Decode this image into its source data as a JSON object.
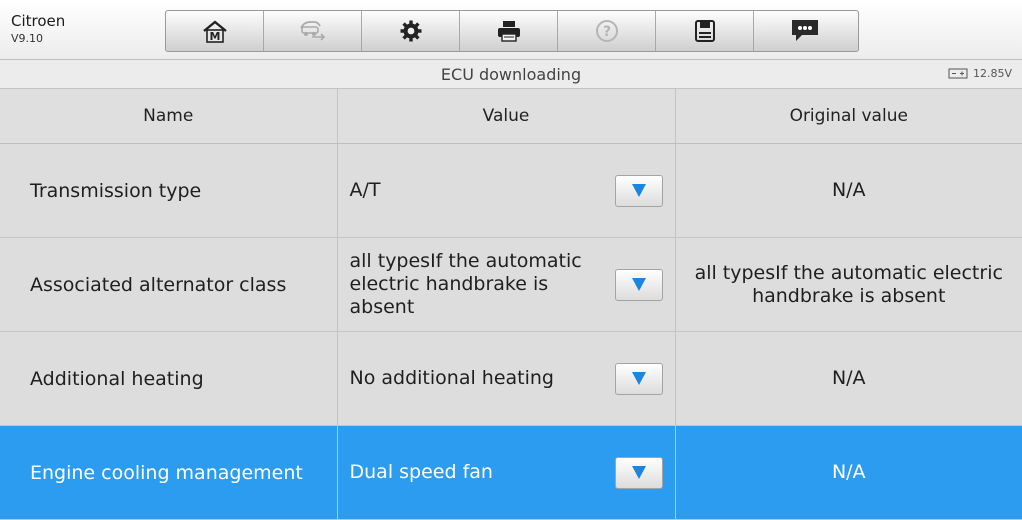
{
  "app": {
    "brand": "Citroen",
    "version": "V9.10"
  },
  "toolbar": {
    "buttons": [
      {
        "icon": "home-icon",
        "label": "M"
      },
      {
        "icon": "vehicle-swap-icon"
      },
      {
        "icon": "gear-icon"
      },
      {
        "icon": "printer-icon"
      },
      {
        "icon": "help-icon",
        "label": "?"
      },
      {
        "icon": "save-icon"
      },
      {
        "icon": "message-icon"
      }
    ]
  },
  "status": {
    "title": "ECU downloading",
    "battery": "12.85V"
  },
  "table": {
    "headers": [
      "Name",
      "Value",
      "Original value"
    ],
    "rows": [
      {
        "name": "Transmission type",
        "value": "A/T",
        "original": "N/A"
      },
      {
        "name": "Associated alternator class",
        "value": "all typesIf the automatic electric handbrake is absent",
        "original": "all typesIf the automatic electric handbrake is absent"
      },
      {
        "name": "Additional heating",
        "value": "No additional heating",
        "original": "N/A"
      },
      {
        "name": "Engine cooling management",
        "value": "Dual speed fan",
        "original": "N/A"
      }
    ]
  },
  "colors": {
    "selected_row": "#2c9cf0",
    "dropdown_arrow": "#1a86df"
  }
}
